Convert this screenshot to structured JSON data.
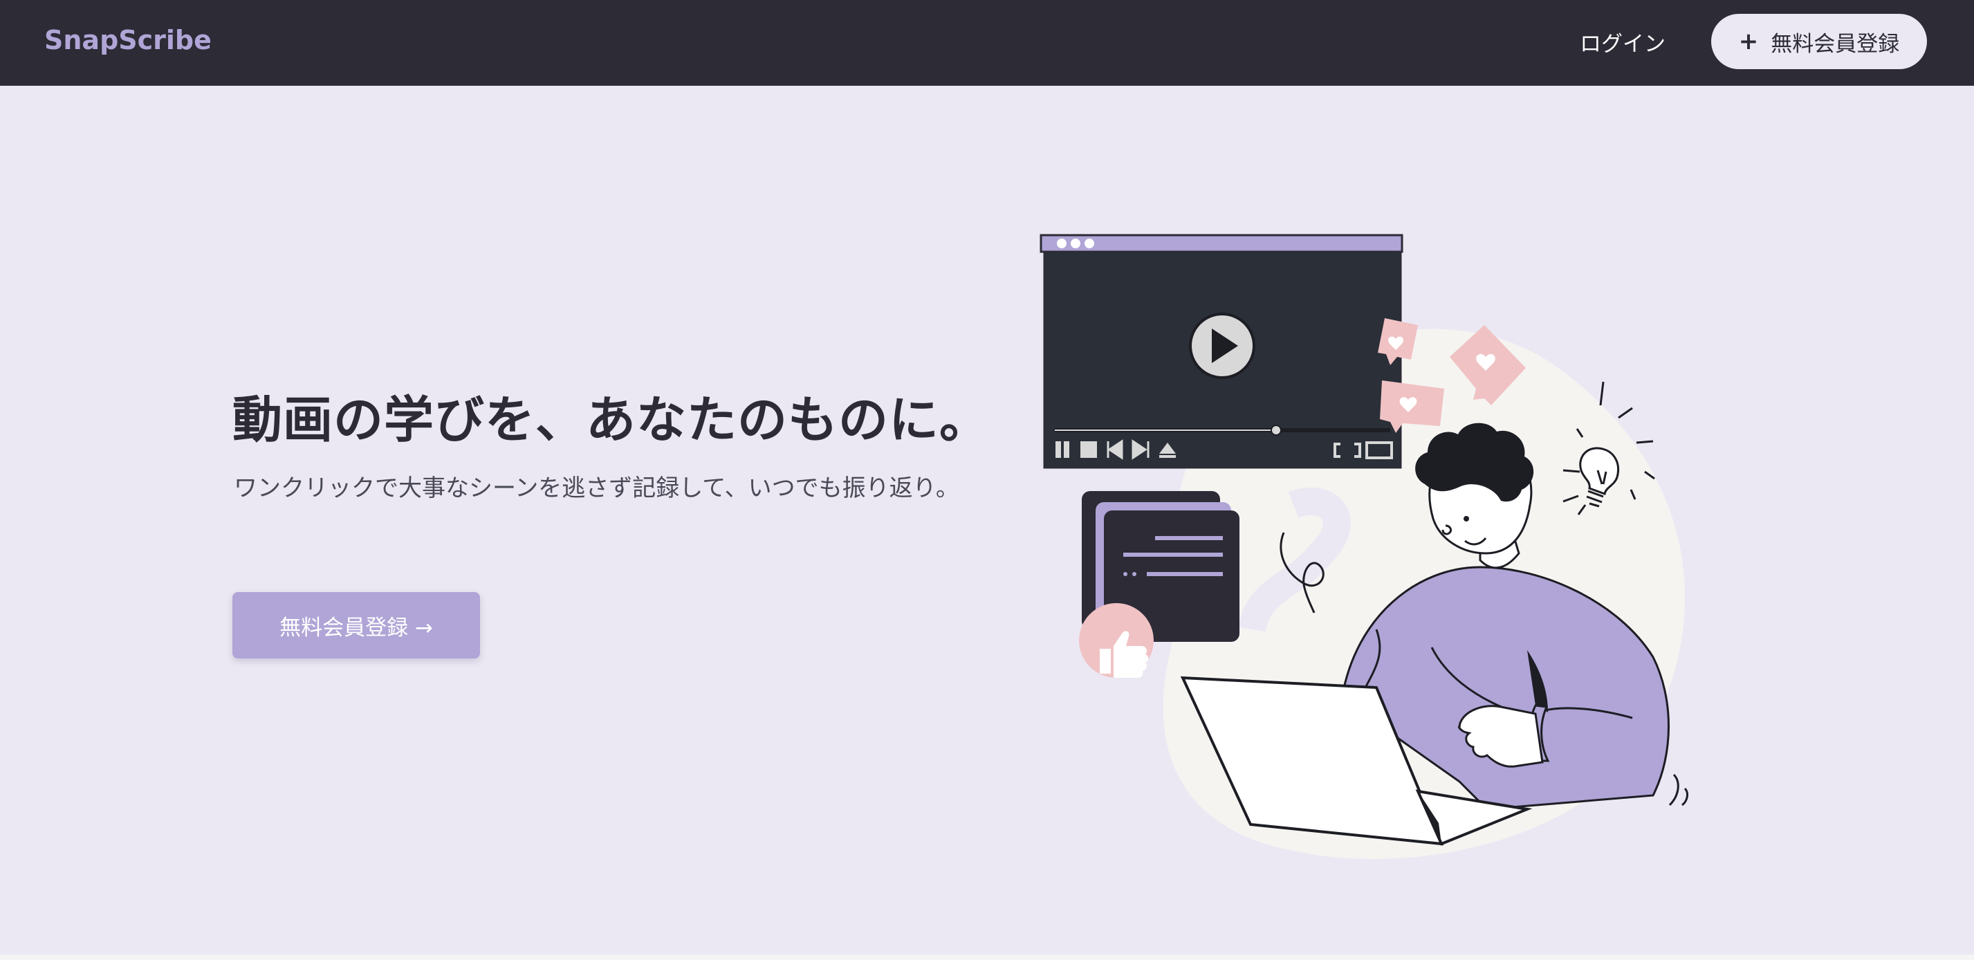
{
  "header": {
    "logo": "SnapScribe",
    "login_label": "ログイン",
    "signup_plus": "+",
    "signup_label": "無料会員登録"
  },
  "hero": {
    "title": "動画の学びを、あなたのものに。",
    "subtitle": "ワンクリックで大事なシーンを逃さず記録して、いつでも振り返り。",
    "cta_label": "無料会員登録 →"
  },
  "colors": {
    "nav_bg": "#2c2b36",
    "page_bg": "#ebe8f3",
    "accent": "#b0a5d6",
    "pink": "#f0c2c4",
    "dark": "#2c2b36"
  },
  "illustration": {
    "icons": [
      "video-player-illustration",
      "play-icon",
      "heart-icon",
      "lightbulb-icon",
      "thumbs-up-icon",
      "laptop-illustration",
      "person-illustration"
    ]
  }
}
